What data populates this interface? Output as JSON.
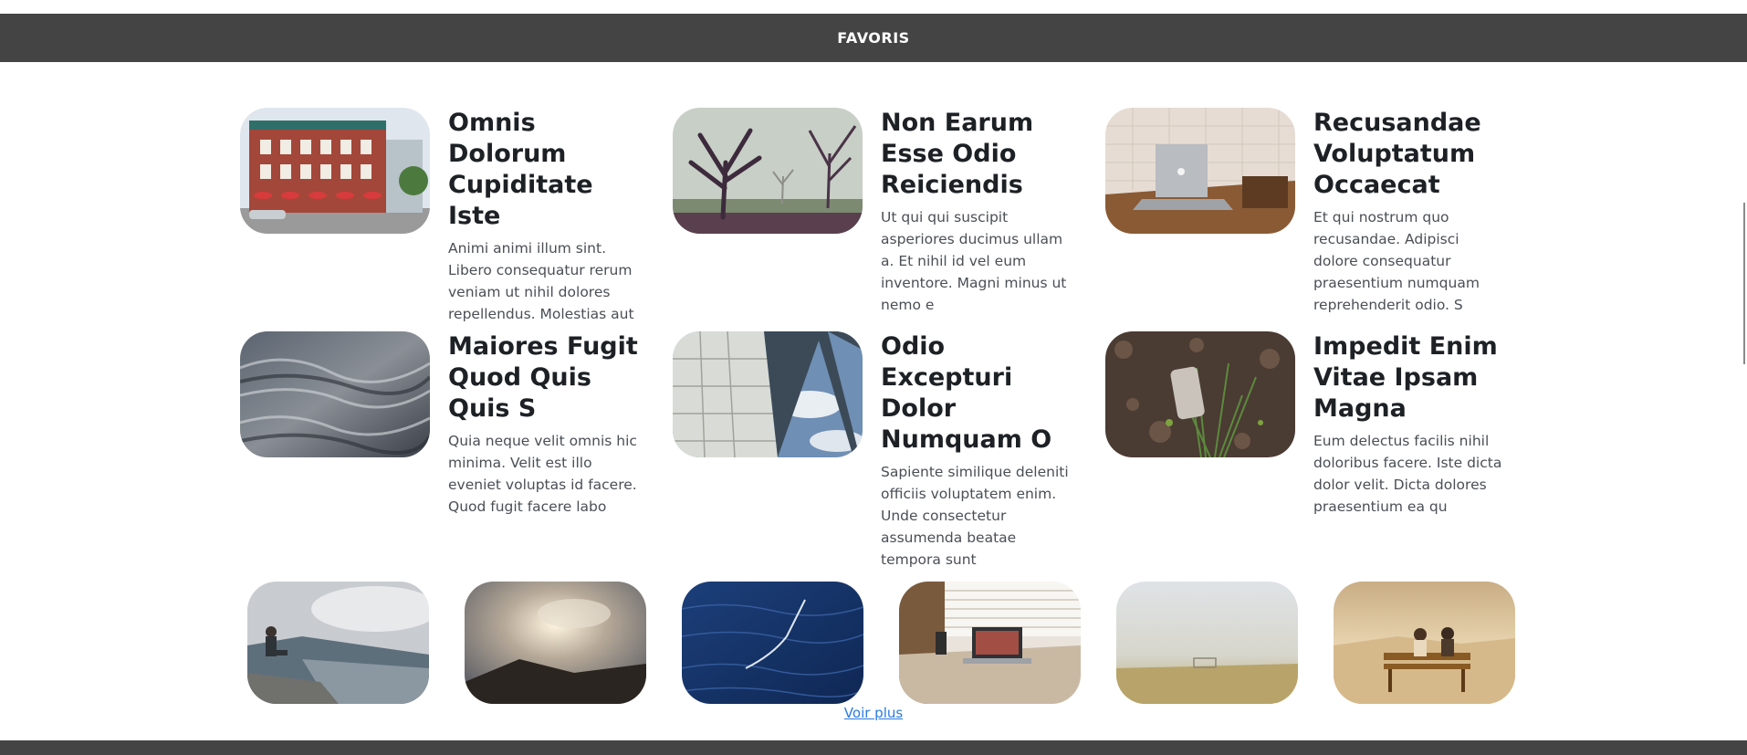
{
  "header": {
    "title": "FAVORIS"
  },
  "cards": [
    {
      "title": "Omnis Dolorum Cupiditate Iste",
      "text": "Animi animi illum sint. Libero consequatur rerum veniam ut nihil dolores repellendus. Molestias aut",
      "image": "street-building-photo"
    },
    {
      "title": "Non Earum Esse Odio Reiciendis",
      "text": "Ut qui qui suscipit asperiores ducimus ullam a. Et nihil id vel eum inventore. Magni minus ut nemo e",
      "image": "misty-trees-photo"
    },
    {
      "title": "Recusandae Voluptatum Occaecat",
      "text": "Et qui nostrum quo recusandae. Adipisci dolore consequatur praesentium numquam reprehenderit odio. S",
      "image": "laptop-desk-photo"
    },
    {
      "title": "Maiores Fugit Quod Quis Quis S",
      "text": "Quia neque velit omnis hic minima. Velit est illo eveniet voluptas id facere. Quod fugit facere labo",
      "image": "water-surface-photo"
    },
    {
      "title": "Odio Excepturi Dolor Numquam O",
      "text": "Sapiente similique deleniti officiis voluptatem enim. Unde consectetur assumenda beatae tempora sunt",
      "image": "sail-sky-photo"
    },
    {
      "title": "Impedit Enim Vitae Ipsam Magna",
      "text": "Eum delectus facilis nihil doloribus facere. Iste dicta dolor velit. Dicta dolores praesentium ea qu",
      "image": "grass-ground-photo"
    }
  ],
  "thumbnails": [
    {
      "image": "man-on-wall-photo"
    },
    {
      "image": "sunburst-hills-photo"
    },
    {
      "image": "deep-ocean-photo"
    },
    {
      "image": "laptop-window-photo"
    },
    {
      "image": "foggy-field-photo"
    },
    {
      "image": "couple-bench-photo"
    }
  ],
  "more_link": "Voir plus",
  "colors": {
    "header_bg": "#444444",
    "link": "#2a7ae2",
    "title": "#1d2125",
    "text": "#4a4f55"
  }
}
